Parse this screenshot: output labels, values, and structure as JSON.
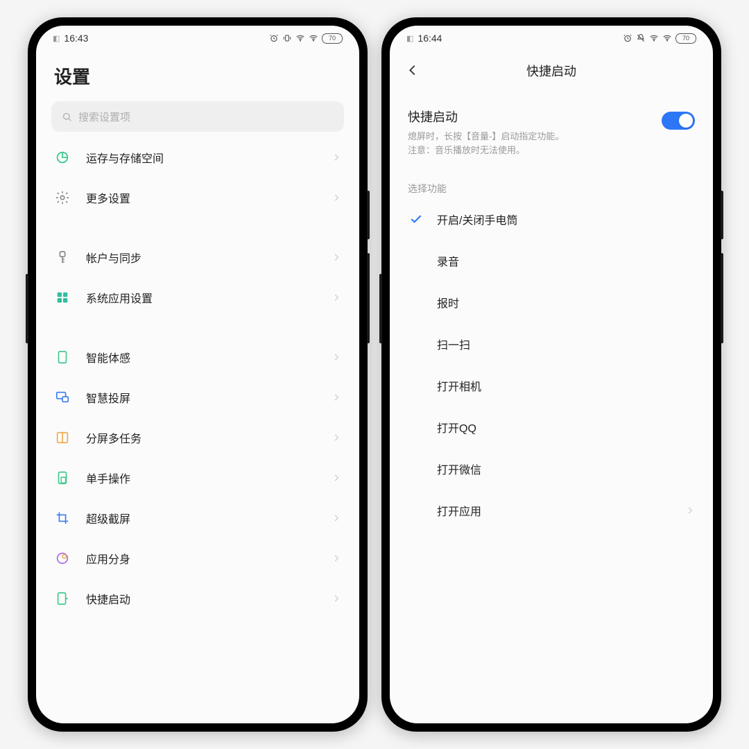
{
  "left": {
    "status": {
      "time": "16:43",
      "battery": "70"
    },
    "title": "设置",
    "search_placeholder": "搜索设置项",
    "groups": [
      [
        {
          "id": "storage",
          "icon": "pie",
          "label": "运存与存储空间"
        },
        {
          "id": "more",
          "icon": "gear",
          "label": "更多设置"
        }
      ],
      [
        {
          "id": "account",
          "icon": "key",
          "label": "帐户与同步"
        },
        {
          "id": "sysapps",
          "icon": "grid",
          "label": "系统应用设置"
        }
      ],
      [
        {
          "id": "motion",
          "icon": "device",
          "label": "智能体感"
        },
        {
          "id": "cast",
          "icon": "cast",
          "label": "智慧投屏"
        },
        {
          "id": "split",
          "icon": "split",
          "label": "分屏多任务"
        },
        {
          "id": "onehand",
          "icon": "onehand",
          "label": "单手操作"
        },
        {
          "id": "screenshot",
          "icon": "crop",
          "label": "超级截屏"
        },
        {
          "id": "appclone",
          "icon": "circle",
          "label": "应用分身"
        },
        {
          "id": "quicklaunch",
          "icon": "launch",
          "label": "快捷启动"
        }
      ]
    ]
  },
  "right": {
    "status": {
      "time": "16:44",
      "battery": "70"
    },
    "nav_title": "快捷启动",
    "toggle": {
      "title": "快捷启动",
      "desc1": "熄屏时，长按【音量-】启动指定功能。",
      "desc2": "注意：音乐播放时无法使用。",
      "on": true
    },
    "section_label": "选择功能",
    "functions": [
      {
        "id": "flashlight",
        "label": "开启/关闭手电筒",
        "checked": true,
        "chevron": false
      },
      {
        "id": "record",
        "label": "录音",
        "checked": false,
        "chevron": false
      },
      {
        "id": "time",
        "label": "报时",
        "checked": false,
        "chevron": false
      },
      {
        "id": "scan",
        "label": "扫一扫",
        "checked": false,
        "chevron": false
      },
      {
        "id": "camera",
        "label": "打开相机",
        "checked": false,
        "chevron": false
      },
      {
        "id": "qq",
        "label": "打开QQ",
        "checked": false,
        "chevron": false
      },
      {
        "id": "wechat",
        "label": "打开微信",
        "checked": false,
        "chevron": false
      },
      {
        "id": "openapp",
        "label": "打开应用",
        "checked": false,
        "chevron": true
      }
    ]
  },
  "colors": {
    "accent_blue": "#2d77f6",
    "text_main": "#222222",
    "text_muted": "#9a9a9a",
    "chevron": "#c8c8c8"
  }
}
